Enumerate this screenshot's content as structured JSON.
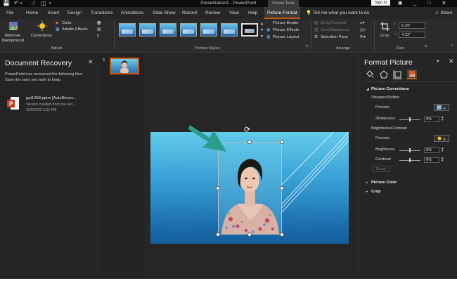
{
  "titlebar": {
    "doc_title": "Presentation1 - PowerPoint",
    "tools_label": "Picture Tools",
    "sign_in": "Sign in"
  },
  "tabs": [
    "File",
    "Home",
    "Insert",
    "Design",
    "Transitions",
    "Animations",
    "Slide Show",
    "Record",
    "Review",
    "View",
    "Help",
    "Picture Format"
  ],
  "active_tab": "Picture Format",
  "tell_me": "Tell me what you want to do",
  "share": "Share",
  "ribbon": {
    "remove_bg_1": "Remove",
    "remove_bg_2": "Background",
    "corrections": "Corrections",
    "color": "Color",
    "artistic_effects": "Artistic Effects",
    "adjust_label": "Adjust",
    "picture_styles_label": "Picture Styles",
    "picture_border": "Picture Border",
    "picture_effects": "Picture Effects",
    "picture_layout": "Picture Layout",
    "bring_forward": "Bring Forward",
    "send_backward": "Send Backward",
    "selection_pane": "Selection Pane",
    "arrange_label": "Arrange",
    "crop": "Crop",
    "height": "6.29\"",
    "width": "4.22\"",
    "size_label": "Size"
  },
  "recovery": {
    "title": "Document Recovery",
    "message": "PowerPoint has recovered the following files.  Save the ones you wish to keep.",
    "file_name": "ppt1068.pptm  [AutoRecov...",
    "file_desc": "Version created from the last...",
    "file_date": "11/8/2022 3:51 PM"
  },
  "slides": {
    "number": "1"
  },
  "format_pane": {
    "title": "Format Picture",
    "section_corrections": "Picture Corrections",
    "sharpen_soften": "Sharpen/Soften",
    "presets_1": "Presets",
    "sharpness": "Sharpness",
    "sharpness_value": "0%",
    "brightness_contrast": "Brightness/Contrast",
    "presets_2": "Presets",
    "brightness": "Brightness",
    "brightness_value": "0%",
    "contrast": "Contrast",
    "contrast_value": "0%",
    "reset": "Reset",
    "section_color": "Picture Color",
    "section_crop": "Crop"
  },
  "colors": {
    "accent": "#c55a11",
    "arrow": "#2a9d8f",
    "slide_top": "#63cbea",
    "slide_bottom": "#135d9a"
  }
}
